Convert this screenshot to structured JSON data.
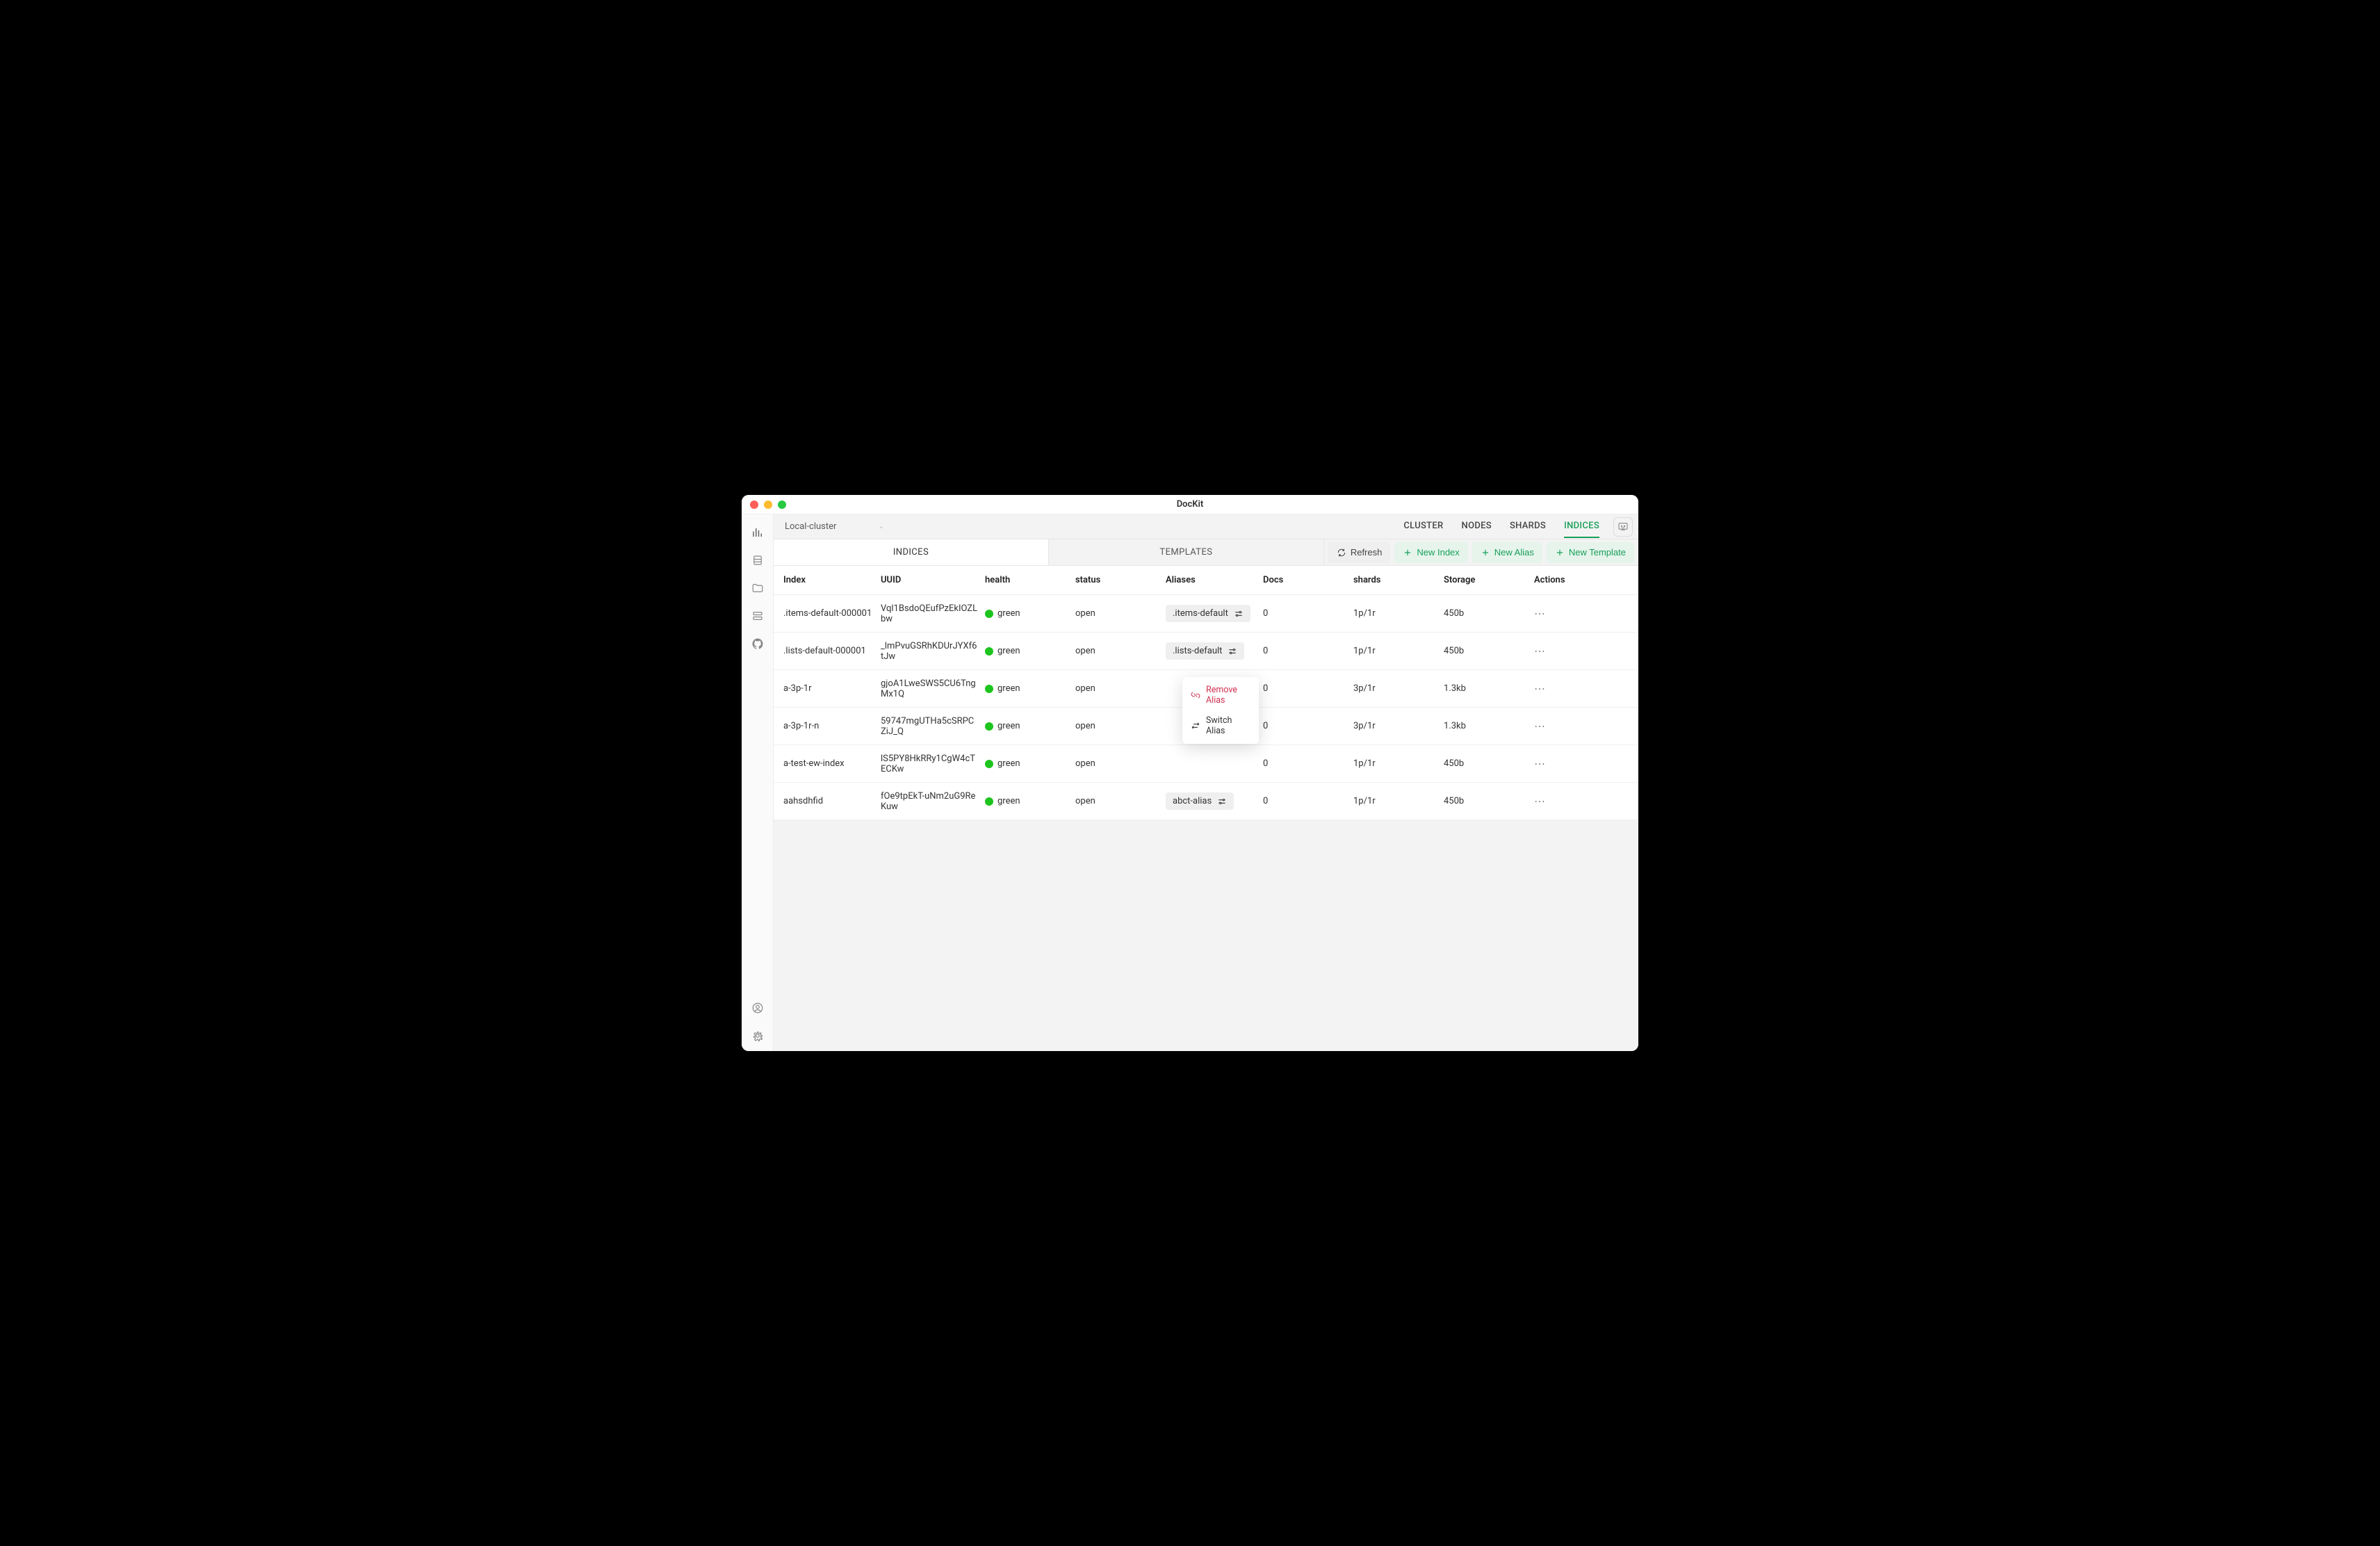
{
  "window": {
    "title": "DocKit"
  },
  "cluster": {
    "selected": "Local-cluster"
  },
  "top_tabs": {
    "cluster": "CLUSTER",
    "nodes": "NODES",
    "shards": "SHARDS",
    "indices": "INDICES"
  },
  "sub_tabs": {
    "indices": "INDICES",
    "templates": "TEMPLATES"
  },
  "actions": {
    "refresh": "Refresh",
    "new_index": "New Index",
    "new_alias": "New Alias",
    "new_template": "New Template"
  },
  "columns": {
    "index": "Index",
    "uuid": "UUID",
    "health": "health",
    "status": "status",
    "aliases": "Aliases",
    "docs": "Docs",
    "shards": "shards",
    "storage": "Storage",
    "actions": "Actions"
  },
  "context_menu": {
    "remove": "Remove Alias",
    "switch": "Switch Alias"
  },
  "rows": [
    {
      "index": ".items-default-000001",
      "uuid": "Vql1BsdoQEufPzEkIOZLbw",
      "health": "green",
      "status": "open",
      "alias": ".items-default",
      "docs": "0",
      "shards": "1p/1r",
      "storage": "450b"
    },
    {
      "index": ".lists-default-000001",
      "uuid": "_lmPvuGSRhKDUrJYXf6tJw",
      "health": "green",
      "status": "open",
      "alias": ".lists-default",
      "docs": "0",
      "shards": "1p/1r",
      "storage": "450b"
    },
    {
      "index": "a-3p-1r",
      "uuid": "gjoA1LweSWS5CU6TngMx1Q",
      "health": "green",
      "status": "open",
      "alias": "",
      "docs": "0",
      "shards": "3p/1r",
      "storage": "1.3kb"
    },
    {
      "index": "a-3p-1r-n",
      "uuid": "59747mgUTHa5cSRPCZiJ_Q",
      "health": "green",
      "status": "open",
      "alias": "",
      "docs": "0",
      "shards": "3p/1r",
      "storage": "1.3kb"
    },
    {
      "index": "a-test-ew-index",
      "uuid": "lS5PY8HkRRy1CgW4cTECKw",
      "health": "green",
      "status": "open",
      "alias": "",
      "docs": "0",
      "shards": "1p/1r",
      "storage": "450b"
    },
    {
      "index": "aahsdhfid",
      "uuid": "fOe9tpEkT-uNm2uG9ReKuw",
      "health": "green",
      "status": "open",
      "alias": "abct-alias",
      "docs": "0",
      "shards": "1p/1r",
      "storage": "450b"
    }
  ]
}
